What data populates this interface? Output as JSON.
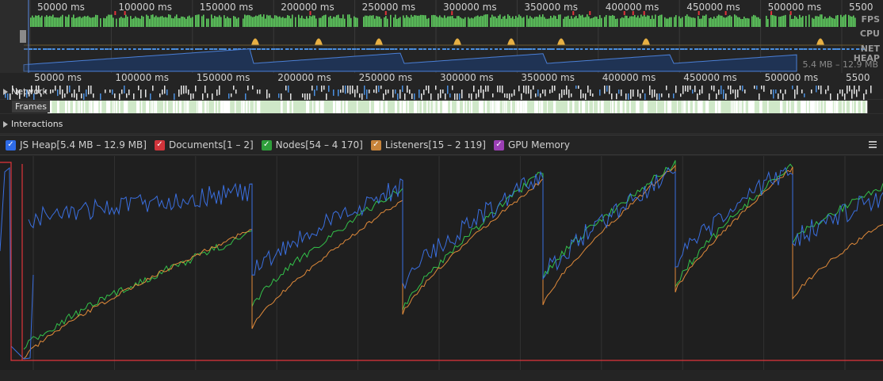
{
  "overview": {
    "tick_labels": [
      "50000 ms",
      "100000 ms",
      "150000 ms",
      "200000 ms",
      "250000 ms",
      "300000 ms",
      "350000 ms",
      "400000 ms",
      "450000 ms",
      "500000 ms",
      "5500"
    ],
    "side_labels": {
      "fps": "FPS",
      "cpu": "CPU",
      "net": "NET",
      "heap": "HEAP"
    },
    "heap_range": "5.4 MB – 12.9 MB"
  },
  "main_axis": {
    "tick_labels": [
      "50000 ms",
      "100000 ms",
      "150000 ms",
      "200000 ms",
      "250000 ms",
      "300000 ms",
      "350000 ms",
      "400000 ms",
      "450000 ms",
      "500000 ms",
      "5500"
    ]
  },
  "tracks": {
    "network": "Network",
    "frames": "Frames",
    "interactions": "Interactions"
  },
  "legend": {
    "items": [
      {
        "label": "JS Heap[5.4 MB – 12.9 MB]",
        "color": "#2e6be6"
      },
      {
        "label": "Documents[1 – 2]",
        "color": "#d1343b"
      },
      {
        "label": "Nodes[54 – 4 170]",
        "color": "#2e9e3a"
      },
      {
        "label": "Listeners[15 – 2 119]",
        "color": "#c8843a"
      },
      {
        "label": "GPU Memory",
        "color": "#9b3fb5"
      }
    ]
  },
  "colors": {
    "js_heap": "#3a6fe0",
    "documents": "#e0353b",
    "nodes": "#33c24a",
    "listeners": "#e08a3a",
    "fps": "#5fcd5f",
    "cpu": "#e8b043",
    "net": "#4a8fe0"
  }
}
